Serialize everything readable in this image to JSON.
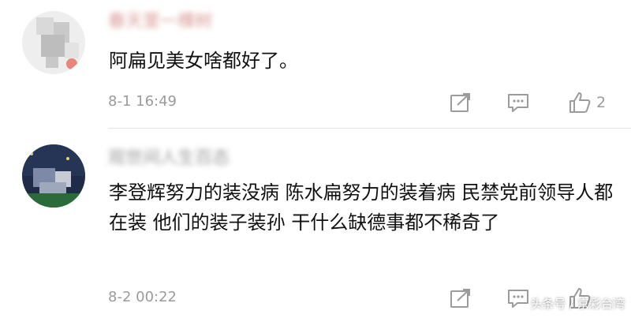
{
  "comments": [
    {
      "username": "春天里一棵树",
      "text": "阿扁见美女啥都好了。",
      "timestamp": "8-1 16:49",
      "likes": "2",
      "avatar_icon": "blurred-avatar-icon"
    },
    {
      "username": "观世间人生百态",
      "text": "李登辉努力的装没病 陈水扁努力的装着病 民禁党前领导人都在装 他们的装子装孙 干什么缺德事都不稀奇了",
      "timestamp": "8-2 00:22",
      "likes": "",
      "avatar_icon": "blurred-avatar-icon"
    }
  ],
  "icons": {
    "share": "share-icon",
    "reply": "reply-icon",
    "like": "thumbs-up-icon"
  },
  "colors": {
    "text": "#111111",
    "meta": "#9b9b9b",
    "divider": "#e6e6e6"
  },
  "watermark": "头条号 / 京彩台湾"
}
